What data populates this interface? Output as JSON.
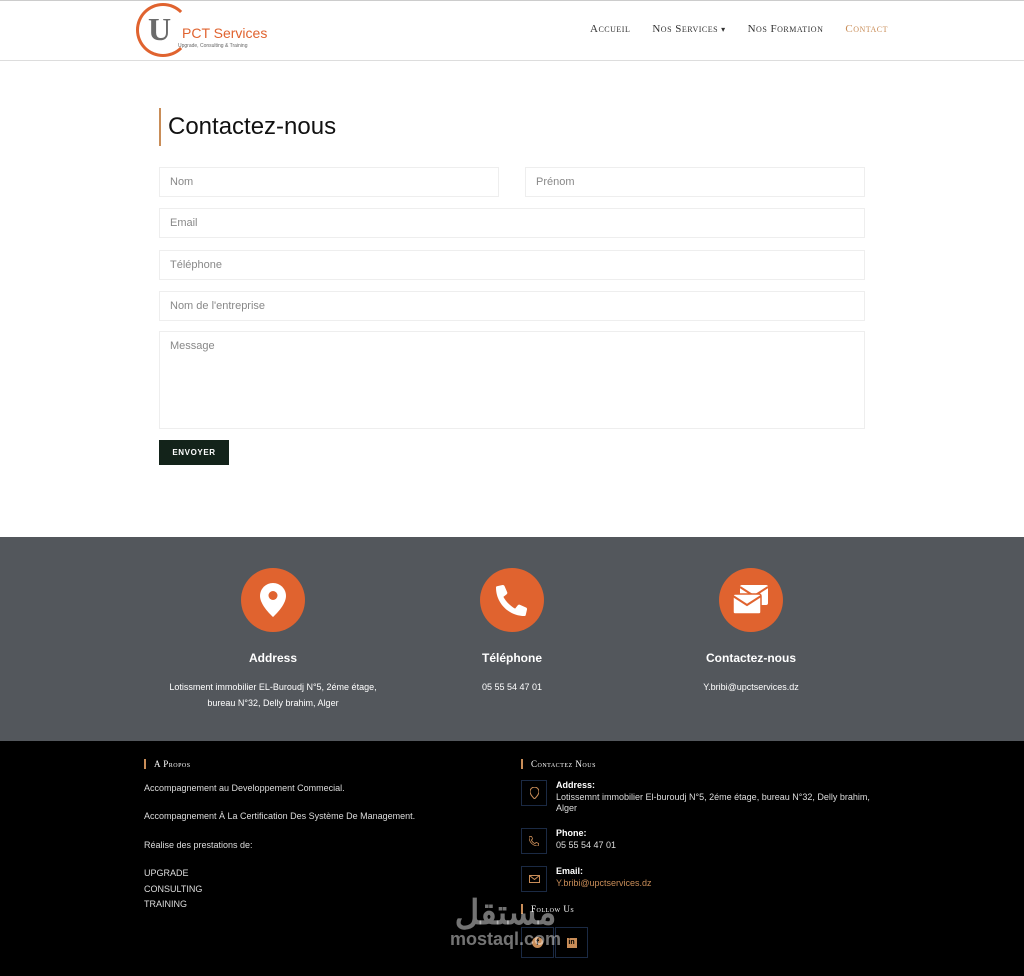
{
  "header": {
    "logo_letter": "U",
    "logo_text": "PCT Services",
    "logo_tagline": "Upgrade, Consulting & Training",
    "nav": [
      {
        "label": "Accueil"
      },
      {
        "label": "Nos Services"
      },
      {
        "label": "Nos Formation"
      },
      {
        "label": "Contact"
      }
    ]
  },
  "contact_form": {
    "title": "Contactez-nous",
    "placeholders": {
      "nom": "Nom",
      "prenom": "Prénom",
      "email": "Email",
      "telephone": "Téléphone",
      "entreprise": "Nom de l'entreprise",
      "message": "Message"
    },
    "submit_label": "ENVOYER"
  },
  "info_band": {
    "address": {
      "title": "Address",
      "text": "Lotissment immobilier EL-Buroudj N°5, 2éme étage, bureau N°32, Delly brahim, Alger"
    },
    "phone": {
      "title": "Téléphone",
      "text": "05 55 54 47 01"
    },
    "contact": {
      "title": "Contactez-nous",
      "text": "Y.bribi@upctservices.dz"
    }
  },
  "footer": {
    "about": {
      "heading": "A Propos",
      "lines": [
        "Accompagnement au Developpement Commecial.",
        "Accompagnement À La Certification Des Système De Management.",
        "Réalise des prestations de:",
        "UPGRADE",
        "CONSULTING",
        "TRAINING"
      ]
    },
    "contact": {
      "heading": "Contactez Nous",
      "address_label": "Address:",
      "address_value": "Lotissemnt immobilier El-buroudj N°5, 2éme étage, bureau N°32, Delly brahim, Alger",
      "phone_label": "Phone:",
      "phone_value": "05 55 54 47 01",
      "email_label": "Email:",
      "email_value": "Y.bribi@upctservices.dz"
    },
    "follow": {
      "heading": "Follow Us"
    }
  },
  "watermark": {
    "arabic": "مستقل",
    "latin": "mostaql.com"
  },
  "colors": {
    "accent": "#e0632f",
    "gold": "#c98d58",
    "band": "#53575c",
    "button": "#13231a"
  }
}
